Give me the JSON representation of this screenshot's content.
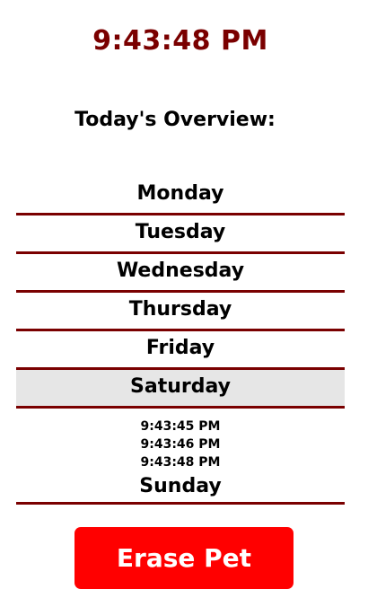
{
  "clock": {
    "time": "9:43:48 PM",
    "color": "#7a0000"
  },
  "overview": {
    "heading": "Today's Overview:"
  },
  "days": [
    {
      "label": "Monday"
    },
    {
      "label": "Tuesday"
    },
    {
      "label": "Wednesday"
    },
    {
      "label": "Thursday"
    },
    {
      "label": "Friday"
    },
    {
      "label": "Saturday",
      "selected": true,
      "log": [
        "9:43:45 PM",
        "9:43:46 PM",
        "9:43:48 PM"
      ]
    },
    {
      "label": "Sunday"
    }
  ],
  "erase_button": {
    "label": "Erase Pet",
    "color": "#ff0000"
  },
  "colors": {
    "divider": "#7a0000",
    "selected_background": "#e6e6e6"
  }
}
